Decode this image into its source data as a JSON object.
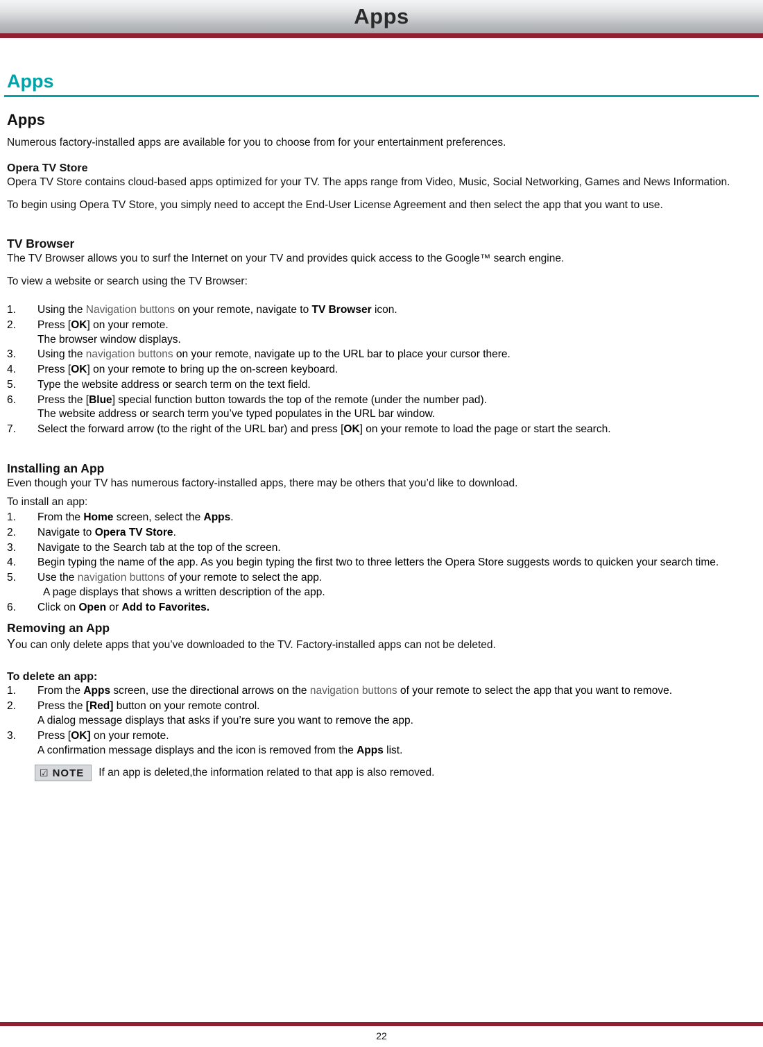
{
  "header": {
    "title": "Apps"
  },
  "chapter": {
    "title": "Apps"
  },
  "sections": {
    "apps": {
      "heading": "Apps",
      "intro": "Numerous factory-installed apps are available for you to choose from for your entertainment preferences.",
      "opera": {
        "heading": "Opera TV Store",
        "p1": "Opera TV Store contains cloud-based apps optimized for your TV. The apps range from Video, Music, Social Networking, Games and News Information.",
        "p2": "To begin using Opera TV Store, you simply need to accept the End-User License Agreement and then select the app that you want to use."
      },
      "browser": {
        "heading": "TV Browser",
        "p1_a": "The TV Browser allows you to surf the Internet on your TV and provides quick access to the Google",
        "p1_tm": "™",
        "p1_b": " search engine.",
        "p2": "To view a website or search using the TV Browser:",
        "steps": [
          {
            "num": "1.",
            "a": "Using the ",
            "grey": "Navigation buttons",
            "b": " on your remote, navigate to ",
            "bold": "TV Browser",
            "c": " icon."
          },
          {
            "num": "2.",
            "a": "Press [",
            "bold": "OK",
            "c": "] on your remote.",
            "cont": "The browser window displays."
          },
          {
            "num": "3.",
            "a": "Using the ",
            "grey": "navigation buttons",
            "b": " on your remote, navigate up to the URL bar to place your cursor there."
          },
          {
            "num": "4.",
            "a": "Press [",
            "bold": "OK",
            "c": "] on your remote to bring up the on-screen keyboard."
          },
          {
            "num": "5.",
            "a": "Type the website address or search term on the text field."
          },
          {
            "num": "6.",
            "a": "Press the [",
            "bold": "Blue",
            "c": "] special function button towards the top of the remote (under the number pad).",
            "cont": "The website address or search term you’ve typed populates in the URL bar window."
          },
          {
            "num": "7.",
            "a": "Select the forward arrow (to the right of the URL bar) and press [",
            "bold": "OK",
            "c": "] on your remote to load the page or start the search."
          }
        ]
      },
      "installing": {
        "heading": "Installing an App",
        "p1": "Even though your TV has numerous factory-installed apps, there may be others that you’d like to download.",
        "p2": "To install an app:",
        "steps": [
          {
            "num": "1.",
            "a": "From the ",
            "bold": "Home",
            "b": " screen, select the ",
            "bold2": "Apps",
            "c": "."
          },
          {
            "num": "2.",
            "a": "Navigate to ",
            "bold": "Opera TV Store",
            "c": "."
          },
          {
            "num": "3.",
            "a": "Navigate to the Search tab at the top of the screen."
          },
          {
            "num": "4.",
            "a": "Begin typing the name of the app. As you begin typing the first two to three letters the Opera Store suggests words to quicken your search time."
          },
          {
            "num": "5.",
            "a": "Use the ",
            "grey": "navigation buttons",
            "b": " of your remote to select the app.",
            "cont": "A page displays that shows a written description of the app."
          },
          {
            "num": "6.",
            "a": "Click on ",
            "bold": "Open",
            "b": " or ",
            "bold2": "Add to Favorites."
          }
        ]
      },
      "removing": {
        "heading": "Removing an App",
        "p1_first": "Y",
        "p1_rest": "ou can only delete apps that you’ve downloaded to the TV. Factory-installed apps can not be deleted.",
        "delete_heading": "To delete an app:",
        "steps": [
          {
            "num": "1.",
            "a": "From the ",
            "bold": "Apps",
            "b": " screen, use the directional arrows on the ",
            "grey": "navigation buttons",
            "c": " of your remote to select the app that you want to remove."
          },
          {
            "num": "2.",
            "a": "Press the ",
            "bold": "[Red]",
            "c": " button on your remote control.",
            "cont": "A dialog message displays that asks if you’re sure you want to remove the app."
          },
          {
            "num": "3.",
            "a": "Press [",
            "bold": "OK]",
            "c": " on your remote.",
            "cont_a": "A confirmation message displays and the icon is removed from the ",
            "cont_bold": "Apps",
            "cont_b": " list."
          }
        ],
        "note": {
          "icon": "checkbox-icon",
          "label": "NOTE",
          "text": "If an app is deleted,the information related to that app is also removed."
        }
      }
    }
  },
  "footer": {
    "page_number": "22"
  },
  "colors": {
    "accent": "#00a4a8",
    "rule": "#8e2031"
  }
}
